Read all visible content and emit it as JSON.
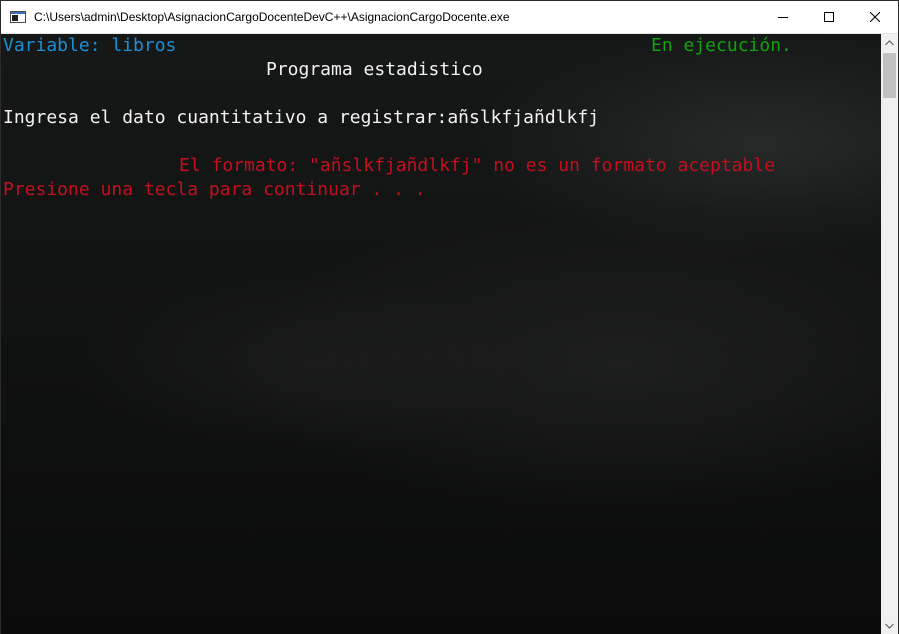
{
  "window": {
    "title": "C:\\Users\\admin\\Desktop\\AsignacionCargoDocenteDevC++\\AsignacionCargoDocente.exe",
    "app_icon": "console-app-icon",
    "controls": [
      "minimize-icon",
      "maximize-icon",
      "close-icon"
    ]
  },
  "console": {
    "variable_label": "Variable: libros",
    "status_label": "En ejecución.",
    "heading": "Programa estadistico",
    "prompt": "Ingresa el dato cuantitativo a registrar:añslkfjañdlkfj",
    "error": "El formato: \"añslkfjañdlkfj\" no es un formato aceptable",
    "continue": "Presione una tecla para continuar . . ."
  },
  "colors": {
    "cyan": "#1b8fd6",
    "green": "#13a10e",
    "white": "#f2f2f2",
    "red": "#c50f1f"
  }
}
